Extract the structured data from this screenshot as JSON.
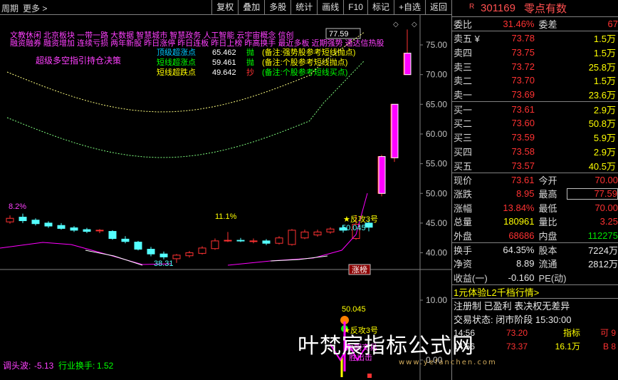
{
  "toolbar": {
    "period": "周期",
    "more": "更多",
    "buttons": [
      "复权",
      "叠加",
      "多股",
      "统计",
      "画线",
      "F10",
      "标记",
      "+自选",
      "返回"
    ]
  },
  "stock": {
    "code": "301169",
    "name": "零点有数",
    "flag": "R"
  },
  "summary": {
    "weibi_label": "委比",
    "weibi_val": "31.46%",
    "weicha_label": "委差",
    "weicha_val": "67"
  },
  "asks": [
    {
      "name": "卖五",
      "mark": "¥",
      "price": "73.78",
      "vol": "1.5万"
    },
    {
      "name": "卖四",
      "mark": "",
      "price": "73.75",
      "vol": "1.5万"
    },
    {
      "name": "卖三",
      "mark": "",
      "price": "73.72",
      "vol": "25.8万"
    },
    {
      "name": "卖二",
      "mark": "",
      "price": "73.70",
      "vol": "1.5万"
    },
    {
      "name": "卖一",
      "mark": "",
      "price": "73.69",
      "vol": "23.6万"
    }
  ],
  "bids": [
    {
      "name": "买一",
      "price": "73.61",
      "vol": "2.9万"
    },
    {
      "name": "买二",
      "price": "73.60",
      "vol": "50.8万"
    },
    {
      "name": "买三",
      "price": "73.59",
      "vol": "5.9万"
    },
    {
      "name": "买四",
      "price": "73.58",
      "vol": "2.9万"
    },
    {
      "name": "买五",
      "price": "73.57",
      "vol": "40.5万"
    }
  ],
  "quote": [
    {
      "l1": "现价",
      "v1": "73.61",
      "l2": "今开",
      "v2": "70.00"
    },
    {
      "l1": "涨跌",
      "v1": "8.95",
      "l2": "最高",
      "v2": "77.59"
    },
    {
      "l1": "涨幅",
      "v1": "13.84%",
      "l2": "最低",
      "v2": "70.00"
    },
    {
      "l1": "总量",
      "v1": "180961",
      "l2": "量比",
      "v2": "3.25"
    },
    {
      "l1": "外盘",
      "v1": "68686",
      "l2": "内盘",
      "v2": "112275"
    }
  ],
  "fund": [
    {
      "l1": "换手",
      "v1": "64.35%",
      "l2": "股本",
      "v2": "7224万"
    },
    {
      "l1": "净资",
      "v1": "8.89",
      "l2": "流通",
      "v2": "2812万"
    },
    {
      "l1": "收益(一)",
      "v1": "-0.160",
      "l2": "PE(动)",
      "v2": ""
    }
  ],
  "promos": [
    "1元体验L2千档行情>",
    "注册制 已盈利 表决权无差异",
    "交易状态: 闭市阶段 15:30:00"
  ],
  "trades": [
    {
      "time": "14:56",
      "price": "73.20",
      "vol": "指标",
      "ex": "可 9"
    },
    {
      "time": "14:56",
      "price": "73.37",
      "vol": "16.1万",
      "ex": "B 8"
    }
  ],
  "chart_data": {
    "type": "candlestick",
    "yaxis_ticks": [
      "75.00",
      "70.00",
      "65.00",
      "60.00",
      "55.00",
      "50.00",
      "45.00",
      "40.00"
    ],
    "sub_yaxis_ticks": [
      "10.00",
      "0.00"
    ],
    "tags_top": "文教休闲 北京板块 一带一路 大数据 智慧城市 智慧政务 人工智能 云宇宙概念 信创",
    "tags_second": "融资融券 融资增加 连续亏损 两年新股 昨日涨停 昨日连板 昨日上榜 昨高换手 最近多板 近期强势 通达信热股",
    "price_box": "77.59",
    "indicator_title": "超级多空指引持仓决策",
    "lines": [
      {
        "name": "顶级超涨点",
        "value": "65.462",
        "action": "抛",
        "note": "(备注:强势股参考短线抛点)"
      },
      {
        "name": "短线超涨点",
        "value": "59.461",
        "action": "抛",
        "note": "(备注:个股参考短线抛点)"
      },
      {
        "name": "短线超跌点",
        "value": "49.642",
        "action": "抄",
        "note": "(备注:个股参考短线买点)"
      }
    ],
    "labels": {
      "pct_left": "8.2%",
      "pct_mid": "11.1%",
      "low": "38.31",
      "star": "★反攻3号",
      "val": "50.045",
      "zhangbang": "涨榜"
    },
    "sub_labels": {
      "val": "50.045",
      "star": "★反攻3号",
      "trade": "短期交易",
      "win": "胜出击"
    },
    "footer": {
      "label1": "调头波:",
      "v1": "-5.13",
      "label2": "行业换手:",
      "v2": "1.52"
    },
    "watermark": "叶梵宸指标公式网",
    "watermark_url": "www.yefanchen.com",
    "candles": [
      {
        "o": 45.2,
        "c": 45.8,
        "h": 46.3,
        "l": 44.9
      },
      {
        "o": 46.0,
        "c": 45.4,
        "h": 46.6,
        "l": 45.0
      },
      {
        "o": 45.5,
        "c": 44.9,
        "h": 45.8,
        "l": 44.6
      },
      {
        "o": 45.0,
        "c": 44.5,
        "h": 45.3,
        "l": 44.2
      },
      {
        "o": 44.6,
        "c": 44.1,
        "h": 45.0,
        "l": 43.9
      },
      {
        "o": 44.2,
        "c": 43.8,
        "h": 44.5,
        "l": 43.5
      },
      {
        "o": 43.9,
        "c": 43.6,
        "h": 44.2,
        "l": 43.3
      },
      {
        "o": 43.7,
        "c": 43.8,
        "h": 44.0,
        "l": 43.3
      },
      {
        "o": 43.6,
        "c": 42.4,
        "h": 43.8,
        "l": 42.2
      },
      {
        "o": 42.3,
        "c": 41.9,
        "h": 42.8,
        "l": 41.6
      },
      {
        "o": 41.8,
        "c": 40.6,
        "h": 42.0,
        "l": 40.4
      },
      {
        "o": 40.6,
        "c": 39.8,
        "h": 41.0,
        "l": 39.4
      },
      {
        "o": 39.8,
        "c": 39.3,
        "h": 40.2,
        "l": 38.9
      },
      {
        "o": 39.0,
        "c": 39.6,
        "h": 39.8,
        "l": 38.3
      },
      {
        "o": 39.5,
        "c": 40.0,
        "h": 40.3,
        "l": 39.2
      },
      {
        "o": 39.9,
        "c": 40.8,
        "h": 41.1,
        "l": 39.7
      },
      {
        "o": 40.7,
        "c": 42.0,
        "h": 42.4,
        "l": 40.5
      },
      {
        "o": 42.0,
        "c": 42.1,
        "h": 43.5,
        "l": 41.8
      },
      {
        "o": 42.1,
        "c": 42.0,
        "h": 42.5,
        "l": 41.8
      },
      {
        "o": 42.0,
        "c": 42.0,
        "h": 42.4,
        "l": 41.6
      },
      {
        "o": 42.0,
        "c": 41.6,
        "h": 42.3,
        "l": 41.3
      },
      {
        "o": 41.6,
        "c": 42.5,
        "h": 42.8,
        "l": 41.4
      },
      {
        "o": 41.4,
        "c": 43.8,
        "h": 44.0,
        "l": 41.2
      },
      {
        "o": 42.5,
        "c": 43.5,
        "h": 43.9,
        "l": 42.3
      },
      {
        "o": 43.0,
        "c": 43.5,
        "h": 43.9,
        "l": 42.7
      },
      {
        "o": 43.5,
        "c": 44.0,
        "h": 44.3,
        "l": 43.2
      },
      {
        "o": 44.2,
        "c": 43.8,
        "h": 44.6,
        "l": 43.4
      },
      {
        "o": 42.4,
        "c": 44.8,
        "h": 46.3,
        "l": 42.2
      },
      {
        "o": 45.0,
        "c": 44.3,
        "h": 45.5,
        "l": 43.6
      },
      {
        "o": 50.0,
        "c": 56.2,
        "h": 56.5,
        "l": 49.5
      },
      {
        "o": 56.0,
        "c": 65.0,
        "h": 65.0,
        "l": 55.3
      },
      {
        "o": 70.0,
        "c": 73.61,
        "h": 77.59,
        "l": 70.0
      }
    ]
  }
}
